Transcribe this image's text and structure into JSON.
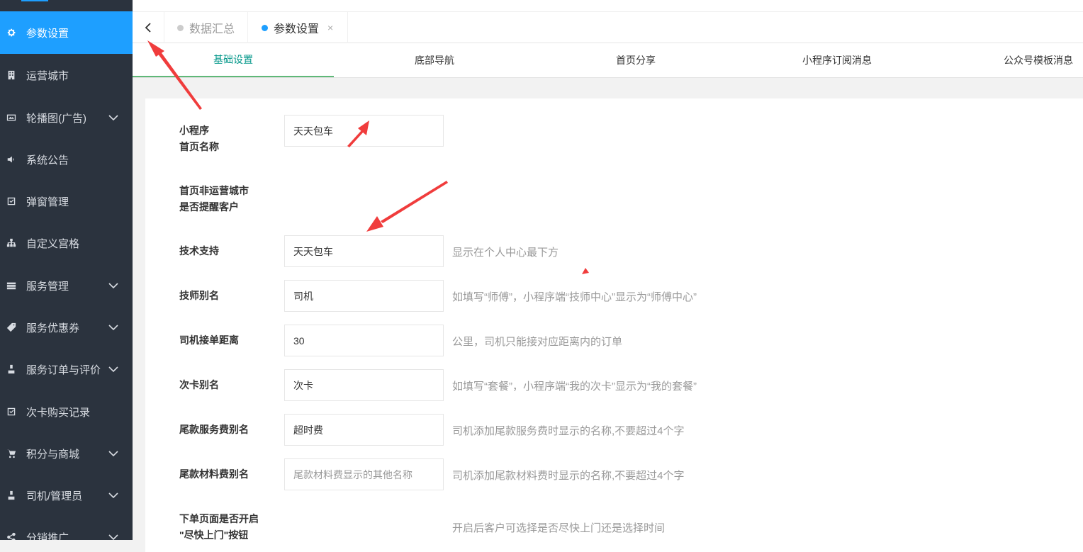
{
  "sidebar": {
    "items": [
      {
        "label": "参数设置",
        "icon": "gear-icon",
        "active": true,
        "expandable": false
      },
      {
        "label": "运营城市",
        "icon": "building-icon",
        "active": false,
        "expandable": false
      },
      {
        "label": "轮播图(广告)",
        "icon": "image-icon",
        "active": false,
        "expandable": true
      },
      {
        "label": "系统公告",
        "icon": "speaker-icon",
        "active": false,
        "expandable": false
      },
      {
        "label": "弹窗管理",
        "icon": "checkbox-icon",
        "active": false,
        "expandable": false
      },
      {
        "label": "自定义宫格",
        "icon": "sitemap-icon",
        "active": false,
        "expandable": false
      },
      {
        "label": "服务管理",
        "icon": "server-icon",
        "active": false,
        "expandable": true
      },
      {
        "label": "服务优惠券",
        "icon": "tag-icon",
        "active": false,
        "expandable": true
      },
      {
        "label": "服务订单与评价",
        "icon": "user-icon",
        "active": false,
        "expandable": true
      },
      {
        "label": "次卡购买记录",
        "icon": "checkbox-icon",
        "active": false,
        "expandable": false
      },
      {
        "label": "积分与商城",
        "icon": "cart-icon",
        "active": false,
        "expandable": true
      },
      {
        "label": "司机/管理员",
        "icon": "user-icon",
        "active": false,
        "expandable": true
      },
      {
        "label": "分销推广",
        "icon": "share-icon",
        "active": false,
        "expandable": true
      }
    ]
  },
  "page_tabs": [
    {
      "label": "数据汇总",
      "active": false,
      "closable": false
    },
    {
      "label": "参数设置",
      "active": true,
      "closable": true,
      "close_glyph": "×"
    }
  ],
  "sub_tabs": [
    {
      "label": "基础设置",
      "active": true
    },
    {
      "label": "底部导航",
      "active": false
    },
    {
      "label": "首页分享",
      "active": false
    },
    {
      "label": "小程序订阅消息",
      "active": false
    },
    {
      "label": "公众号模板消息",
      "active": false
    }
  ],
  "form": {
    "rows": [
      {
        "label_lines": [
          "小程序",
          "首页名称"
        ],
        "value": "天天包车",
        "placeholder": "",
        "hint": ""
      },
      {
        "label_lines": [
          "首页非运营城市",
          "是否提醒客户"
        ],
        "value": null,
        "placeholder": "",
        "hint": ""
      },
      {
        "label_lines": [
          "技术支持"
        ],
        "value": "天天包车",
        "placeholder": "",
        "hint": "显示在个人中心最下方"
      },
      {
        "label_lines": [
          "技师别名"
        ],
        "value": "司机",
        "placeholder": "",
        "hint": "如填写“师傅”，小程序端“技师中心”显示为“师傅中心”"
      },
      {
        "label_lines": [
          "司机接单距离"
        ],
        "value": "30",
        "placeholder": "",
        "hint": "公里，司机只能接对应距离内的订单"
      },
      {
        "label_lines": [
          "次卡别名"
        ],
        "value": "次卡",
        "placeholder": "",
        "hint": "如填写“套餐”，小程序端“我的次卡”显示为“我的套餐”"
      },
      {
        "label_lines": [
          "尾款服务费别名"
        ],
        "value": "超时费",
        "placeholder": "",
        "hint": "司机添加尾款服务费时显示的名称,不要超过4个字"
      },
      {
        "label_lines": [
          "尾款材料费别名"
        ],
        "value": "",
        "placeholder": "尾款材料费显示的其他名称",
        "hint": "司机添加尾款材料费时显示的名称,不要超过4个字"
      },
      {
        "label_lines": [
          "下单页面是否开启",
          "\"尽快上门\"按钮"
        ],
        "value": null,
        "placeholder": "",
        "hint": "开启后客户可选择是否尽快上门还是选择时间"
      }
    ]
  },
  "colors": {
    "sidebar_bg": "#2b333e",
    "accent": "#1e9fff",
    "subtab_active": "#009688",
    "annotation_arrow": "#f03c3c"
  }
}
